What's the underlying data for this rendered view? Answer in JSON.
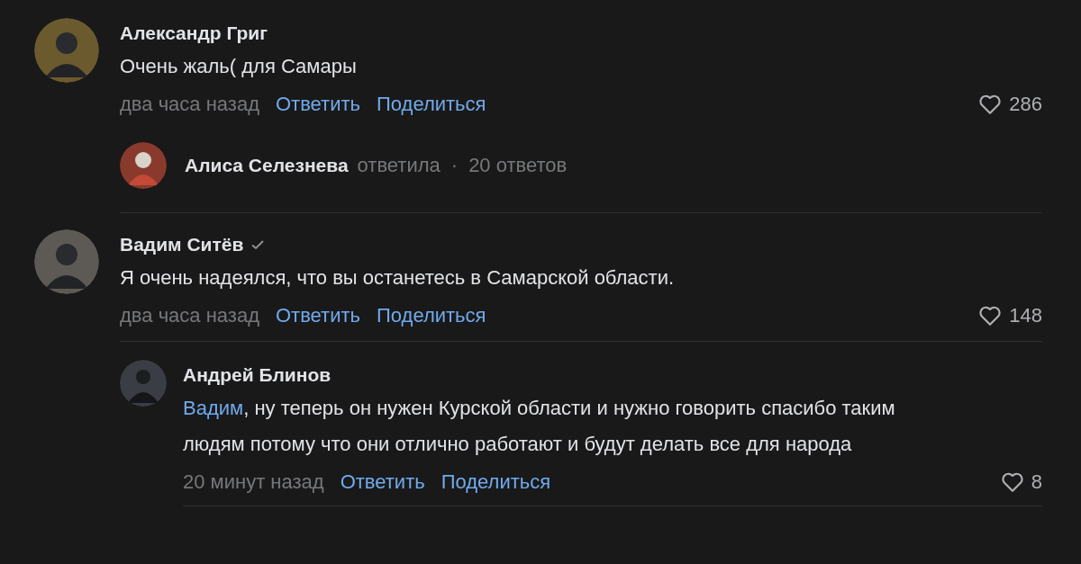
{
  "comments": [
    {
      "author": "Александр Григ",
      "verified": false,
      "text": "Очень жаль( для Самары",
      "time": "два часа назад",
      "actions": [
        "Ответить",
        "Поделиться"
      ],
      "likes": "286",
      "reply_summary": {
        "author": "Алиса Селезнева",
        "verb": "ответила",
        "separator": "·",
        "count": "20 ответов"
      }
    },
    {
      "author": "Вадим Ситёв",
      "verified": true,
      "text": "Я очень надеялся, что вы останетесь в Самарской области.",
      "time": "два часа назад",
      "actions": [
        "Ответить",
        "Поделиться"
      ],
      "likes": "148",
      "replies": [
        {
          "author": "Андрей Блинов",
          "mention": "Вадим",
          "text": ", ну теперь он нужен Курской области и нужно говорить спасибо таким людям потому что они отлично работают и будут делать все для народа",
          "time": "20 минут назад",
          "actions": [
            "Ответить",
            "Поделиться"
          ],
          "likes": "8"
        }
      ]
    }
  ]
}
